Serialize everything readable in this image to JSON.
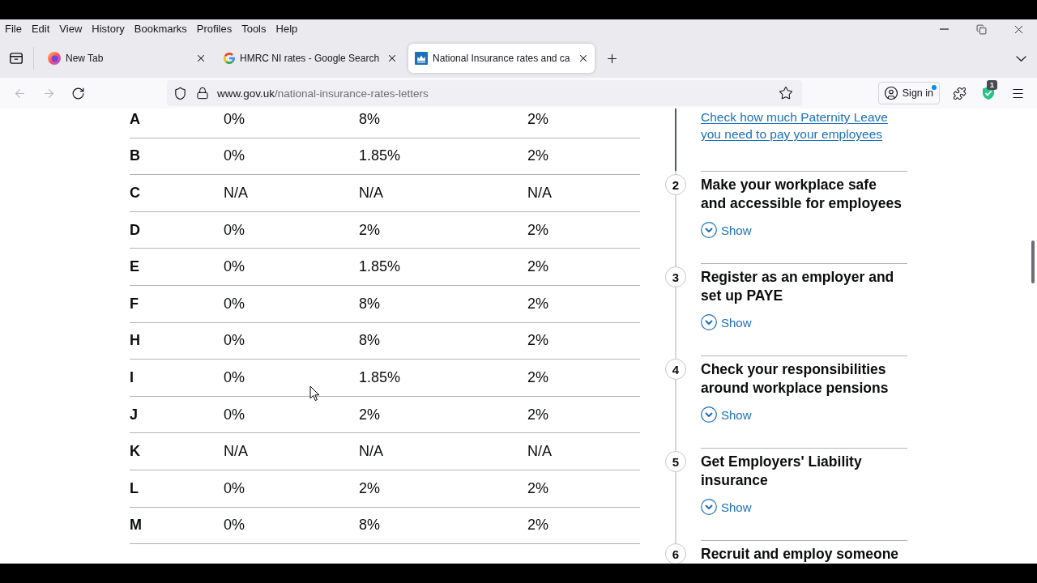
{
  "menu_bar": {
    "items": [
      "File",
      "Edit",
      "View",
      "History",
      "Bookmarks",
      "Profiles",
      "Tools",
      "Help"
    ]
  },
  "tabs": [
    {
      "title": "New Tab",
      "selected": false
    },
    {
      "title": "HMRC NI rates - Google Search",
      "selected": false
    },
    {
      "title": "National Insurance rates and ca",
      "selected": true
    }
  ],
  "nav_buttons": [
    {
      "kind": "back",
      "disabled": true
    },
    {
      "kind": "forward",
      "disabled": true
    },
    {
      "kind": "reload",
      "disabled": false
    }
  ],
  "address_bar": {
    "host": "www.gov.uk",
    "path": "/national-insurance-rates-letters"
  },
  "toolbar": {
    "sign_in": {
      "label": "Sign in",
      "notification": true
    },
    "extension_badge": "1"
  },
  "table": {
    "rows": [
      {
        "cells": [
          "A",
          "0%",
          "8%",
          "2%"
        ]
      },
      {
        "cells": [
          "B",
          "0%",
          "1.85%",
          "2%"
        ]
      },
      {
        "cells": [
          "C",
          "N/A",
          "N/A",
          "N/A"
        ]
      },
      {
        "cells": [
          "D",
          "0%",
          "2%",
          "2%"
        ]
      },
      {
        "cells": [
          "E",
          "0%",
          "1.85%",
          "2%"
        ]
      },
      {
        "cells": [
          "F",
          "0%",
          "8%",
          "2%"
        ]
      },
      {
        "cells": [
          "H",
          "0%",
          "8%",
          "2%"
        ]
      },
      {
        "cells": [
          "I",
          "0%",
          "1.85%",
          "2%"
        ]
      },
      {
        "cells": [
          "J",
          "0%",
          "2%",
          "2%"
        ]
      },
      {
        "cells": [
          "K",
          "N/A",
          "N/A",
          "N/A"
        ]
      },
      {
        "cells": [
          "L",
          "0%",
          "2%",
          "2%"
        ]
      },
      {
        "cells": [
          "M",
          "0%",
          "8%",
          "2%"
        ]
      }
    ]
  },
  "step_by_step": {
    "link": "Check how much Paternity Leave you need to pay your employees",
    "steps": [
      {
        "number": "2",
        "title": "Make your workplace safe and accessible for employees",
        "toggle": "Show",
        "expanded": false
      },
      {
        "number": "3",
        "title": "Register as an employer and set up PAYE",
        "toggle": "Show",
        "expanded": false
      },
      {
        "number": "4",
        "title": "Check your responsibilities around workplace pensions",
        "toggle": "Show",
        "expanded": false
      },
      {
        "number": "5",
        "title": "Get Employers' Liability insurance",
        "toggle": "Show",
        "expanded": false
      },
      {
        "number": "6",
        "title": "Recruit and employ someone"
      }
    ]
  }
}
